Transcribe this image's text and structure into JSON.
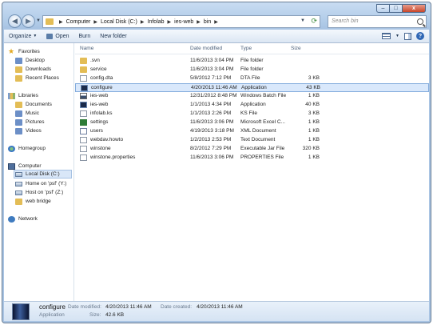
{
  "caption_buttons": {
    "minimize": "–",
    "maximize": "□",
    "close": "x"
  },
  "address": {
    "crumbs": [
      "Computer",
      "Local Disk (C:)",
      "Infolab",
      "ies-web",
      "bin"
    ],
    "search_placeholder": "Search bin"
  },
  "toolbar": {
    "organize": "Organize",
    "open": "Open",
    "burn": "Burn",
    "new_folder": "New folder"
  },
  "nav": {
    "favorites": "Favorites",
    "desktop": "Desktop",
    "downloads": "Downloads",
    "recent": "Recent Places",
    "libraries": "Libraries",
    "documents": "Documents",
    "music": "Music",
    "pictures": "Pictures",
    "videos": "Videos",
    "homegroup": "Homegroup",
    "computer": "Computer",
    "local_disk": "Local Disk (C:)",
    "home_psf": "Home on 'psf' (Y:)",
    "host_psf": "Host on 'psf' (Z:)",
    "web_bridge": "web bridge",
    "network": "Network"
  },
  "columns": {
    "name": "Name",
    "date": "Date modified",
    "type": "Type",
    "size": "Size"
  },
  "files": [
    {
      "name": ".svn",
      "date": "11/6/2013 3:04 PM",
      "type": "File folder",
      "size": "",
      "icon": "folder"
    },
    {
      "name": "service",
      "date": "11/6/2013 3:04 PM",
      "type": "File folder",
      "size": "",
      "icon": "folder"
    },
    {
      "name": "config.dta",
      "date": "5/8/2012 7:12 PM",
      "type": "DTA File",
      "size": "3 KB",
      "icon": "doc"
    },
    {
      "name": "configure",
      "date": "4/20/2013 11:46 AM",
      "type": "Application",
      "size": "43 KB",
      "icon": "app"
    },
    {
      "name": "ies-web",
      "date": "12/31/2012 8:48 PM",
      "type": "Windows Batch File",
      "size": "1 KB",
      "icon": "batch"
    },
    {
      "name": "ies-web",
      "date": "1/1/2013 4:34 PM",
      "type": "Application",
      "size": "40 KB",
      "icon": "app"
    },
    {
      "name": "infolab.ks",
      "date": "1/1/2013 2:26 PM",
      "type": "KS File",
      "size": "3 KB",
      "icon": "doc"
    },
    {
      "name": "settings",
      "date": "11/6/2013 3:06 PM",
      "type": "Microsoft Excel C...",
      "size": "1 KB",
      "icon": "excel"
    },
    {
      "name": "users",
      "date": "4/19/2013 3:18 PM",
      "type": "XML Document",
      "size": "1 KB",
      "icon": "xml"
    },
    {
      "name": "webdav.howto",
      "date": "1/2/2013 2:53 PM",
      "type": "Text Document",
      "size": "1 KB",
      "icon": "doc"
    },
    {
      "name": "winstone",
      "date": "8/2/2012 7:29 PM",
      "type": "Executable Jar File",
      "size": "320 KB",
      "icon": "jar"
    },
    {
      "name": "winstone.properties",
      "date": "11/6/2013 3:06 PM",
      "type": "PROPERTIES File",
      "size": "1 KB",
      "icon": "doc"
    }
  ],
  "selected_file_index": 3,
  "details": {
    "name": "configure",
    "type": "Application",
    "modified_label": "Date modified:",
    "modified": "4/20/2013 11:46 AM",
    "created_label": "Date created:",
    "created": "4/20/2013 11:46 AM",
    "size_label": "Size:",
    "size": "42.6 KB"
  }
}
